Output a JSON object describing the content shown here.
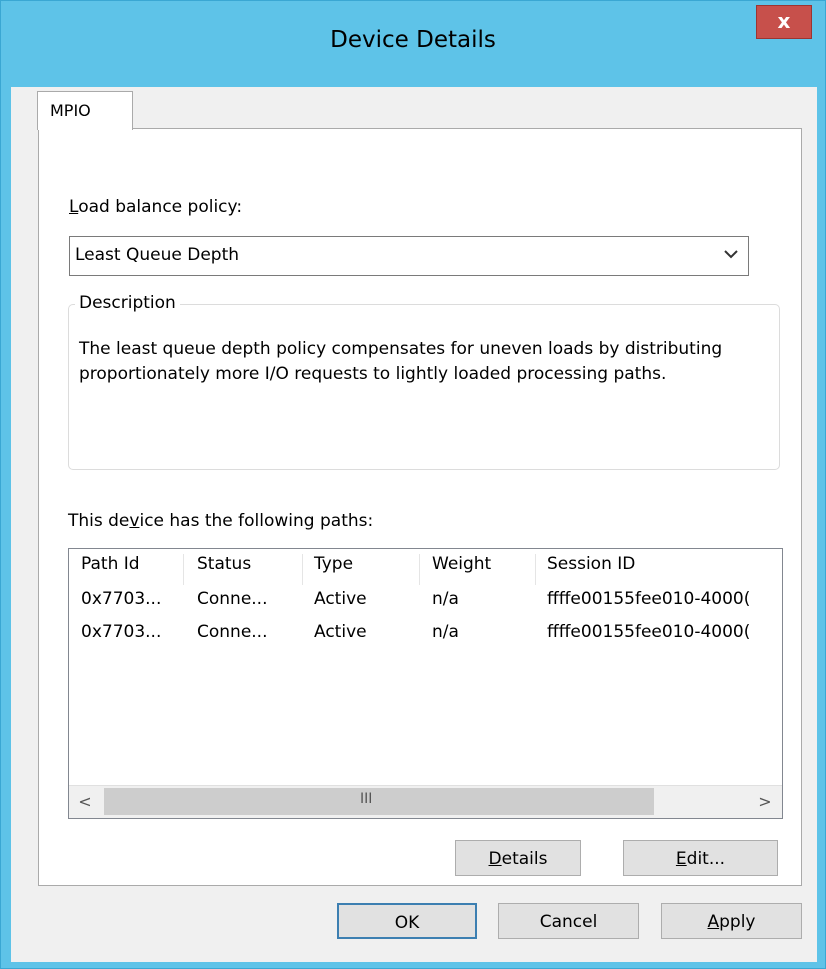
{
  "window": {
    "title": "Device Details",
    "close_label": "x"
  },
  "tabs": [
    {
      "label": "MPIO"
    }
  ],
  "load_balance": {
    "label_prefix": "L",
    "label_rest": "oad balance policy:",
    "selected": "Least Queue Depth"
  },
  "description": {
    "title": "Description",
    "text": "The least queue depth policy compensates for uneven loads by distributing proportionately more I/O requests to lightly loaded processing paths."
  },
  "paths": {
    "label_a": "This de",
    "label_ul": "v",
    "label_b": "ice has the following paths:",
    "columns": [
      "Path Id",
      "Status",
      "Type",
      "Weight",
      "Session ID"
    ],
    "rows": [
      [
        "0x7703...",
        "Conne...",
        "Active",
        "n/a",
        "ffffe00155fee010-4000("
      ],
      [
        "0x7703...",
        "Conne...",
        "Active",
        "n/a",
        "ffffe00155fee010-4000("
      ]
    ],
    "scroll_left": "<",
    "scroll_right": ">",
    "scroll_grip": "III"
  },
  "buttons": {
    "details_ul": "D",
    "details_rest": "etails",
    "edit_ul": "E",
    "edit_rest": "dit...",
    "ok": "OK",
    "cancel": "Cancel",
    "apply_ul": "A",
    "apply_rest": "pply"
  }
}
